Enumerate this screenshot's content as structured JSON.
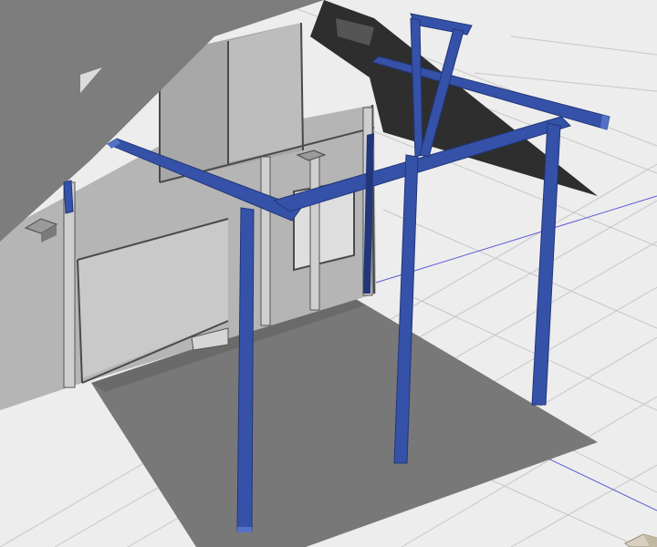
{
  "viewport": {
    "title": "",
    "colors": {
      "background": "#ededed",
      "grid_line": "#c6c6c6",
      "axis_line": "#5b5bd6",
      "floor_shadow": "#787878",
      "roof": "#7d7d7d",
      "roof_shadow": "#2e2e2e",
      "wall": "#b5b5b5",
      "wall_light": "#c9c9c9",
      "timber_edge": "#3a3a3a",
      "beam_blue": "#3552a8",
      "beam_blue_light": "#5471c8",
      "beam_blue_dark": "#22367a"
    },
    "objects": {
      "existing_house": "gray-house-model",
      "pergola_frame": "blue-timber-pergola",
      "ground": "grid-ground-plane",
      "view_cube": "navigation-corner"
    }
  }
}
